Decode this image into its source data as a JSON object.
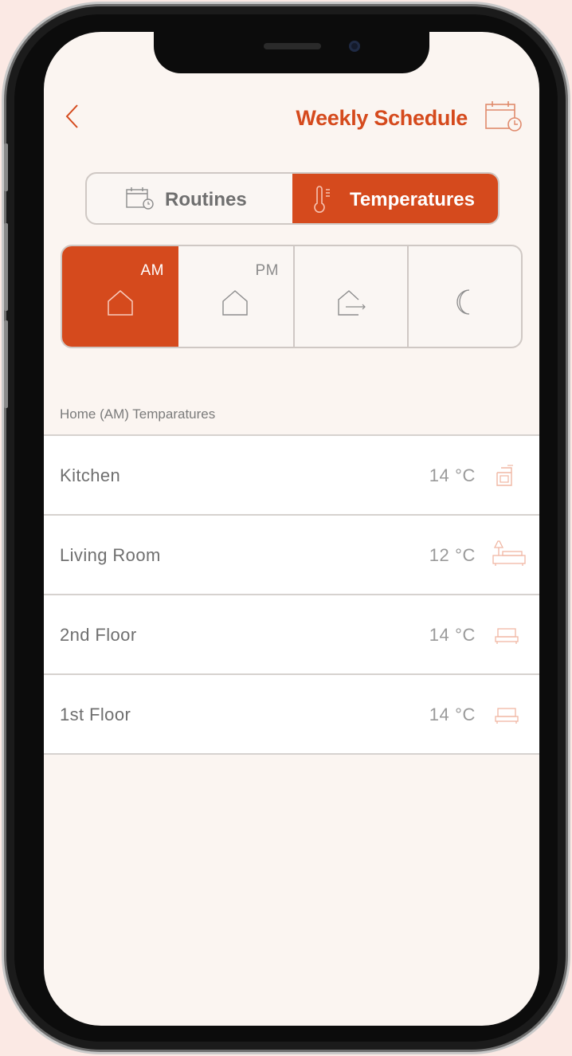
{
  "header": {
    "title": "Weekly Schedule",
    "back_icon": "chevron-left-icon",
    "calendar_icon": "calendar-clock-icon",
    "accent_color": "#d54a1d"
  },
  "segments": [
    {
      "label": "Routines",
      "icon": "calendar-clock-icon",
      "selected": false
    },
    {
      "label": "Temperatures",
      "icon": "thermometer-icon",
      "selected": true
    }
  ],
  "modes": [
    {
      "label": "AM",
      "icon": "home-icon",
      "selected": true
    },
    {
      "label": "PM",
      "icon": "home-icon",
      "selected": false
    },
    {
      "label": "",
      "icon": "leave-home-icon",
      "selected": false
    },
    {
      "label": "",
      "icon": "moon-icon",
      "selected": false
    }
  ],
  "section_label": "Home (AM) Temparatures",
  "rooms": [
    {
      "name": "Kitchen",
      "temp": "14 °C",
      "icon": "oven-icon"
    },
    {
      "name": "Living Room",
      "temp": "12 °C",
      "icon": "sofa-lamp-icon"
    },
    {
      "name": "2nd Floor",
      "temp": "14 °C",
      "icon": "bed-icon"
    },
    {
      "name": "1st Floor",
      "temp": "14 °C",
      "icon": "bed-icon"
    }
  ]
}
